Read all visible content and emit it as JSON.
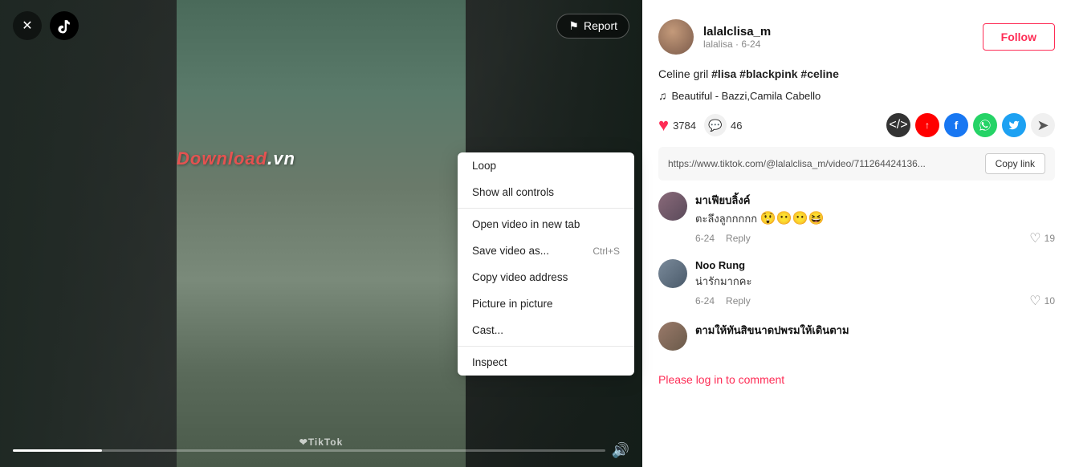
{
  "video": {
    "watermark": "@❤TikTok",
    "report_label": "Report"
  },
  "context_menu": {
    "items": [
      {
        "label": "Loop",
        "shortcut": ""
      },
      {
        "label": "Show all controls",
        "shortcut": ""
      },
      {
        "label": "Open video in new tab",
        "shortcut": ""
      },
      {
        "label": "Save video as...",
        "shortcut": "Ctrl+S"
      },
      {
        "label": "Copy video address",
        "shortcut": ""
      },
      {
        "label": "Picture in picture",
        "shortcut": ""
      },
      {
        "label": "Cast...",
        "shortcut": ""
      },
      {
        "label": "Inspect",
        "shortcut": ""
      }
    ]
  },
  "right_panel": {
    "username": "lalalclisa_m",
    "user_sub": "lalalisa · 6-24",
    "follow_label": "Follow",
    "caption_normal": "Celine gril ",
    "caption_tags": "#lisa #blackpink #celine",
    "music": "Beautiful - Bazzi,Camila Cabello",
    "likes_count": "3784",
    "comments_count": "46",
    "link_url": "https://www.tiktok.com/@lalalclisa_m/video/711264424136...",
    "copy_link_label": "Copy link",
    "comments": [
      {
        "id": 1,
        "name": "มาเฟียบลิ้งค์",
        "text": "ตะลึงลูกกกกก",
        "emojis": "😲😶😶😆",
        "date": "6-24",
        "reply_label": "Reply",
        "likes": "19"
      },
      {
        "id": 2,
        "name": "Noo Rung",
        "text": "น่ารักมากคะ",
        "emojis": "",
        "date": "6-24",
        "reply_label": "Reply",
        "likes": "10"
      },
      {
        "id": 3,
        "name": "ตามให้ทันสิขนาดปพรมให้เดินตาม",
        "text": "",
        "emojis": "",
        "date": "",
        "reply_label": "",
        "likes": ""
      }
    ],
    "login_prompt": "Please log in to comment"
  }
}
